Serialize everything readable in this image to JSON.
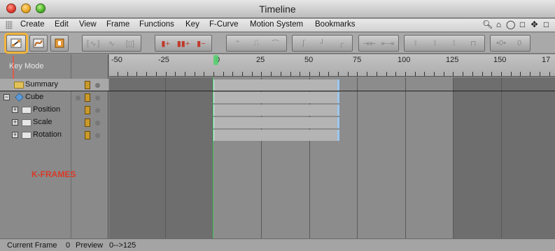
{
  "window": {
    "title": "Timeline"
  },
  "menu": {
    "items": [
      "Create",
      "Edit",
      "View",
      "Frame",
      "Functions",
      "Key",
      "F-Curve",
      "Motion System",
      "Bookmarks"
    ],
    "right_icons": [
      "search-icon",
      "home-icon",
      "hide-icon",
      "new-window-icon",
      "move-icon",
      "expand-icon"
    ]
  },
  "left_panel": {
    "mode_label": "Key Mode",
    "rows": [
      {
        "label": "Summary",
        "type": "summary"
      },
      {
        "label": "Cube",
        "type": "object"
      },
      {
        "label": "Position",
        "type": "track"
      },
      {
        "label": "Scale",
        "type": "track"
      },
      {
        "label": "Rotation",
        "type": "track"
      }
    ],
    "annotation": "K-FRAMES"
  },
  "ruler": {
    "labels": [
      "-50",
      "-25",
      "0",
      "25",
      "50",
      "75",
      "100",
      "125",
      "150",
      "17"
    ]
  },
  "status": {
    "current_frame_label": "Current Frame",
    "current_frame_value": "0",
    "preview_label": "Preview",
    "preview_value": "0-->125"
  },
  "colors": {
    "highlight_outline": "#f2b53a",
    "annotation_red": "#d63b28",
    "current_frame_green": "#3ec35a",
    "key_end_blue": "#9cc8ef"
  }
}
